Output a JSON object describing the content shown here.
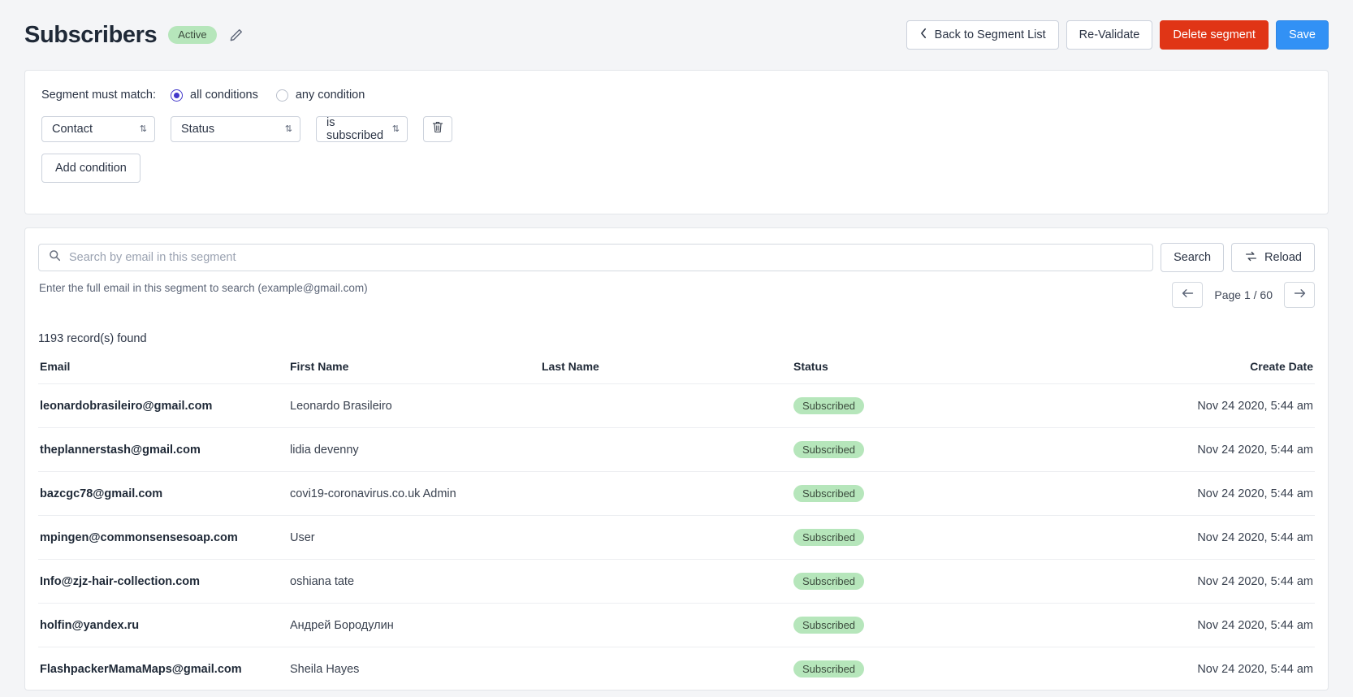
{
  "header": {
    "title": "Subscribers",
    "status": "Active",
    "edit_icon": "pencil-icon",
    "actions": {
      "back": "Back to Segment List",
      "revalidate": "Re-Validate",
      "delete": "Delete segment",
      "save": "Save"
    }
  },
  "conditions": {
    "match_label": "Segment must match:",
    "options": [
      {
        "label": "all conditions",
        "checked": true
      },
      {
        "label": "any condition",
        "checked": false
      }
    ],
    "rows": [
      {
        "entity": "Contact",
        "field": "Status",
        "operator": "is subscribed",
        "delete_icon": "trash-icon"
      }
    ],
    "add_button": "Add condition"
  },
  "search": {
    "placeholder": "Search by email in this segment",
    "value": "",
    "icon": "search-icon",
    "search_button": "Search",
    "reload_button": "Reload",
    "reload_icon": "refresh-icon",
    "hint": "Enter the full email in this segment to search (example@gmail.com)"
  },
  "pagination": {
    "prev_icon": "arrow-left-icon",
    "next_icon": "arrow-right-icon",
    "label": "Page 1 / 60"
  },
  "table": {
    "records_found": "1193 record(s) found",
    "columns": [
      "Email",
      "First Name",
      "Last Name",
      "Status",
      "Create Date"
    ],
    "rows": [
      {
        "email": "leonardobrasileiro@gmail.com",
        "first_name": "Leonardo Brasileiro",
        "last_name": "",
        "status": "Subscribed",
        "create_date": "Nov 24 2020, 5:44 am"
      },
      {
        "email": "theplannerstash@gmail.com",
        "first_name": "lidia devenny",
        "last_name": "",
        "status": "Subscribed",
        "create_date": "Nov 24 2020, 5:44 am"
      },
      {
        "email": "bazcgc78@gmail.com",
        "first_name": "covi19-coronavirus.co.uk Admin",
        "last_name": "",
        "status": "Subscribed",
        "create_date": "Nov 24 2020, 5:44 am"
      },
      {
        "email": "mpingen@commonsensesoap.com",
        "first_name": "User",
        "last_name": "",
        "status": "Subscribed",
        "create_date": "Nov 24 2020, 5:44 am"
      },
      {
        "email": "Info@zjz-hair-collection.com",
        "first_name": "oshiana tate",
        "last_name": "",
        "status": "Subscribed",
        "create_date": "Nov 24 2020, 5:44 am"
      },
      {
        "email": "holfin@yandex.ru",
        "first_name": "Андрей Бородулин",
        "last_name": "",
        "status": "Subscribed",
        "create_date": "Nov 24 2020, 5:44 am"
      },
      {
        "email": "FlashpackerMamaMaps@gmail.com",
        "first_name": "Sheila Hayes",
        "last_name": "",
        "status": "Subscribed",
        "create_date": "Nov 24 2020, 5:44 am"
      }
    ]
  },
  "colors": {
    "danger": "#e03516",
    "primary": "#3291f5",
    "badge_green": "#b6e6bb",
    "radio_accent": "#4338ca"
  }
}
